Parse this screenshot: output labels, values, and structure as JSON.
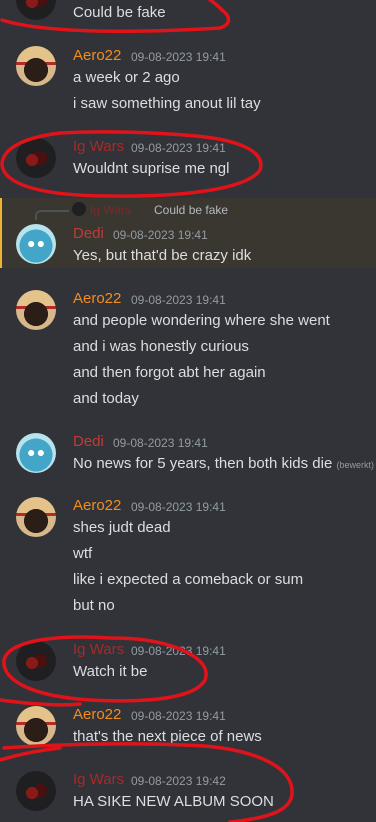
{
  "colors": {
    "scribble": "#e0131a",
    "reply_highlight": "#f0b232"
  },
  "messages": [
    {
      "lines": [
        "Could be fake"
      ]
    },
    {
      "author": "Aero22",
      "time": "09-08-2023 19:41",
      "lines": [
        "a week or 2 ago",
        "i saw something anout lil tay"
      ]
    },
    {
      "author": "Ig Wars",
      "time": "09-08-2023 19:41",
      "lines": [
        "Wouldnt suprise me ngl"
      ]
    },
    {
      "reply_to": {
        "author": "Ig Wars",
        "text": "Could be fake"
      },
      "author": "Dedi",
      "time": "09-08-2023 19:41",
      "lines": [
        "Yes, but that'd be crazy idk"
      ]
    },
    {
      "author": "Aero22",
      "time": "09-08-2023 19:41",
      "lines": [
        "and people wondering where she went",
        "and i was honestly curious",
        "and then forgot abt her again",
        "and today"
      ]
    },
    {
      "author": "Dedi",
      "time": "09-08-2023 19:41",
      "lines": [
        "No news for 5 years, then both kids die"
      ],
      "edited": "(bewerkt)"
    },
    {
      "author": "Aero22",
      "time": "09-08-2023 19:41",
      "lines": [
        "shes judt dead",
        "wtf",
        "like i expected a comeback or sum",
        "but no"
      ]
    },
    {
      "author": "Ig Wars",
      "time": "09-08-2023 19:41",
      "lines": [
        "Watch it be"
      ]
    },
    {
      "author": "Aero22",
      "time": "09-08-2023 19:41",
      "lines": [
        "that's the next piece of news"
      ]
    },
    {
      "author": "Ig Wars",
      "time": "09-08-2023 19:42",
      "lines": [
        "HA SIKE NEW ALBUM SOON"
      ]
    }
  ]
}
